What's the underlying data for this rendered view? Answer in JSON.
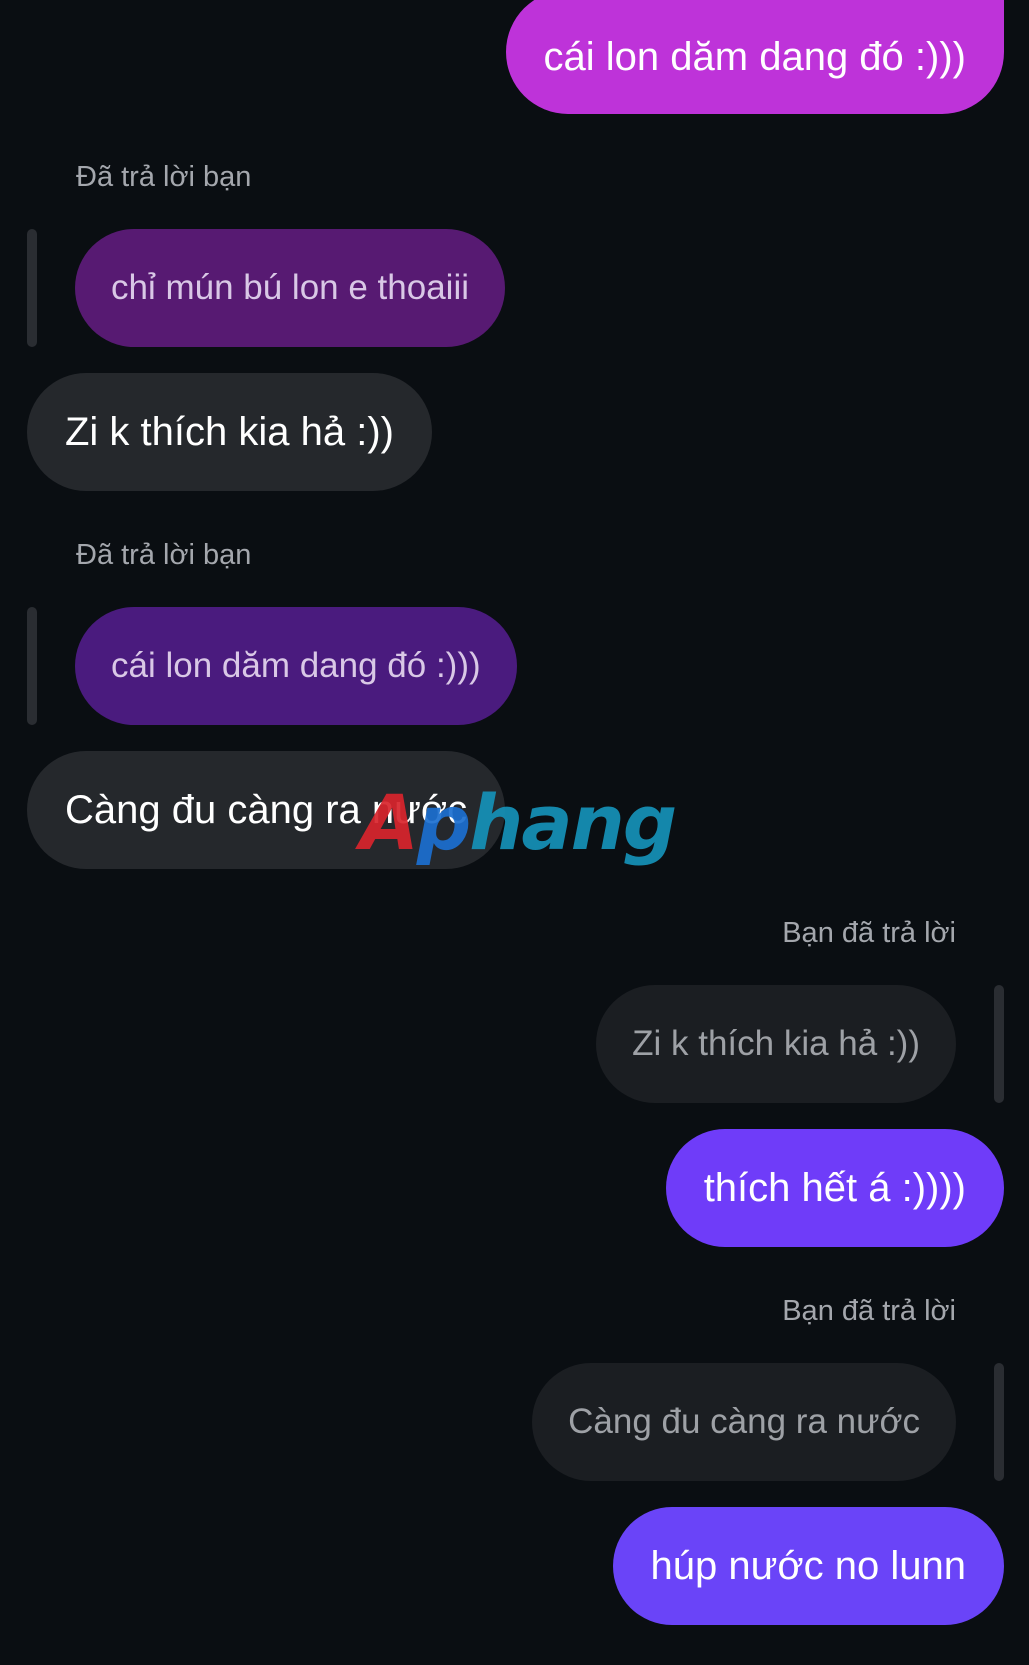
{
  "messages": {
    "m1": {
      "text": "cái lon dăm dang đó :)))"
    },
    "m2": {
      "reply_label": "Đã trả lời bạn",
      "quoted": "chỉ mún bú lon e thoaiii",
      "text": "Zi k thích kia hả :))"
    },
    "m3": {
      "reply_label": "Đã trả lời bạn",
      "quoted": "cái lon dăm dang đó :)))",
      "text": "Càng đu càng ra nước"
    },
    "m4": {
      "reply_label": "Bạn đã trả lời",
      "quoted": "Zi k thích kia hả :))",
      "text": "thích hết á :))))"
    },
    "m5": {
      "reply_label": "Bạn đã trả lời",
      "quoted": "Càng đu càng ra nước",
      "text": "húp nước no lunn"
    }
  },
  "watermark": {
    "text": "Aphang"
  },
  "colors": {
    "background": "#0a0e12",
    "outgoing_gradient_top": "#c032d8",
    "outgoing_gradient_bottom": "#6a44f8",
    "incoming": "#25282c",
    "quote_incoming_1": "#571a72",
    "quote_incoming_2": "#4a1b7e",
    "quote_outgoing": "#1b1e22"
  }
}
